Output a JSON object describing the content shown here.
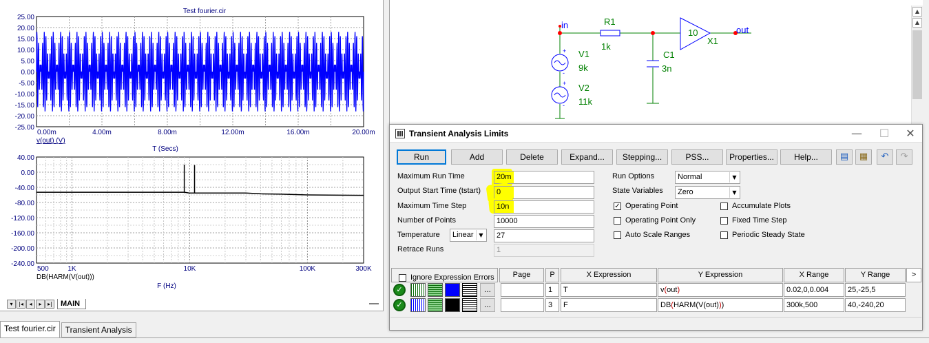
{
  "plot_pane": {
    "top_chart": {
      "title": "Test fourier.cir",
      "y_ticks": [
        "25.00",
        "20.00",
        "15.00",
        "10.00",
        "5.00",
        "0.00",
        "-5.00",
        "-10.00",
        "-15.00",
        "-20.00",
        "-25.00"
      ],
      "x_ticks": [
        "0.00m",
        "4.00m",
        "8.00m",
        "12.00m",
        "16.00m",
        "20.00m"
      ],
      "trace_label": "v(out) (V)",
      "xlabel": "T (Secs)",
      "trace_color": "#0000ff"
    },
    "bottom_chart": {
      "y_ticks": [
        "40.00",
        "0.00",
        "-40.00",
        "-80.00",
        "-120.00",
        "-160.00",
        "-200.00",
        "-240.00"
      ],
      "x_ticks": [
        "500",
        "1K",
        "10K",
        "100K",
        "300K"
      ],
      "trace_label": "DB(HARM(V(out)))",
      "xlabel": "F (Hz)",
      "trace_color": "#000000"
    },
    "nav_buttons": [
      "▾",
      "|◂",
      "◂",
      "▸",
      "▸|"
    ],
    "tab_label": "MAIN"
  },
  "chart_data": [
    {
      "type": "line",
      "title": "Test fourier.cir",
      "xlabel": "T (Secs)",
      "ylabel": "",
      "xlim": [
        0,
        0.02
      ],
      "ylim": [
        -25,
        25
      ],
      "grid": true,
      "series": [
        {
          "name": "v(out) (V)",
          "description_points": {
            "x": [
              0,
              0.02
            ],
            "amplitude": 18.5
          }
        }
      ]
    },
    {
      "type": "line",
      "xlabel": "F (Hz)",
      "ylabel": "",
      "x_scale": "log",
      "xlim": [
        500,
        300000
      ],
      "ylim": [
        -240,
        40
      ],
      "grid": true,
      "series": [
        {
          "name": "DB(HARM(V(out)))",
          "x": [
            500,
            5000,
            9000,
            9000,
            9000,
            9900,
            10000,
            11000,
            11000,
            11000,
            12000,
            30000,
            40000,
            60000,
            100000,
            300000
          ],
          "y": [
            -53,
            -53,
            -53,
            20,
            -53,
            -55,
            -55,
            -55,
            19,
            -55,
            -55,
            -55,
            -57,
            -58,
            -60,
            -61
          ]
        }
      ]
    }
  ],
  "doc_tabs": [
    "Test fourier.cir",
    "Transient Analysis"
  ],
  "schematic": {
    "labels": {
      "in": "in",
      "r1": "R1",
      "r1_val": "1k",
      "c1": "C1",
      "c1_val": "3n",
      "v1": "V1",
      "v1_val": "9k",
      "v2": "V2",
      "v2_val": "11k",
      "amp_gain": "10",
      "x1": "X1",
      "out": "out",
      "plus": "+",
      "minus": "-"
    },
    "colors": {
      "wire": "#008000",
      "component": "#0000ff",
      "node": "#ff0000"
    }
  },
  "dialog": {
    "title": "Transient Analysis Limits",
    "window_controls": [
      "—",
      "☐",
      "✕"
    ],
    "buttons": {
      "run": "Run",
      "add": "Add",
      "delete": "Delete",
      "expand": "Expand...",
      "stepping": "Stepping...",
      "pss": "PSS...",
      "properties": "Properties...",
      "help": "Help..."
    },
    "icon_buttons": [
      "copy-icon",
      "paste-icon",
      "undo-icon",
      "redo-icon"
    ],
    "fields": {
      "max_run_time_label": "Maximum Run Time",
      "max_run_time": "20m",
      "output_start_label": "Output Start Time (tstart)",
      "output_start": "0",
      "max_time_step_label": "Maximum Time Step",
      "max_time_step": "10n",
      "num_points_label": "Number of Points",
      "num_points": "10000",
      "temperature_label": "Temperature",
      "temperature_mode": "Linear",
      "temperature": "27",
      "retrace_label": "Retrace Runs",
      "retrace": "1"
    },
    "run_options_label": "Run Options",
    "run_options": "Normal",
    "state_vars_label": "State Variables",
    "state_vars": "Zero",
    "checkboxes": {
      "operating_point": {
        "label": "Operating Point",
        "checked": "✓"
      },
      "operating_point_only": {
        "label": "Operating Point Only",
        "checked": ""
      },
      "auto_scale": {
        "label": "Auto Scale Ranges",
        "checked": ""
      },
      "accumulate": {
        "label": "Accumulate Plots",
        "checked": ""
      },
      "fixed_step": {
        "label": "Fixed Time Step",
        "checked": ""
      },
      "periodic": {
        "label": "Periodic Steady State",
        "checked": ""
      },
      "ignore_expr": {
        "label": "Ignore Expression Errors",
        "checked": ""
      }
    },
    "table": {
      "headers": {
        "page": "Page",
        "p": "P",
        "x": "X Expression",
        "y": "Y Expression",
        "xr": "X Range",
        "yr": "Y Range",
        "arrow": ">"
      },
      "rows": [
        {
          "page": "",
          "p": "1",
          "x": "T",
          "y_pre": "v",
          "y_par_open": "(",
          "y_mid": "out",
          "y_par_close": ")",
          "y_post": "",
          "xr": "0.02,0,0.004",
          "yr": "25,-25,5",
          "color": "#0000ff",
          "ok": "✓",
          "ellipsis": "..."
        },
        {
          "page": "",
          "p": "3",
          "x": "F",
          "y_pre": "DB",
          "y_par_open": "(",
          "y_mid": "HARM(V(out)",
          "y_par_close": ")",
          "y_post": ")",
          "xr": "300k,500",
          "yr": "40,-240,20",
          "color": "#000000",
          "ok": "✓",
          "ellipsis": "..."
        }
      ]
    }
  }
}
